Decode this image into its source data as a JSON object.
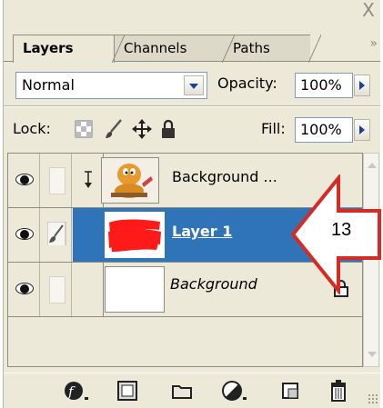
{
  "titlebar": {
    "close_glyph": "X"
  },
  "tabs": [
    {
      "label": "Layers",
      "active": true
    },
    {
      "label": "Channels",
      "active": false
    },
    {
      "label": "Paths",
      "active": false
    }
  ],
  "panel_menu_glyph": "»",
  "blend": {
    "mode": "Normal",
    "opacity_label": "Opacity:",
    "opacity_value": "100%"
  },
  "lock": {
    "label": "Lock:",
    "fill_label": "Fill:",
    "fill_value": "100%"
  },
  "layers": [
    {
      "name": "Background ...",
      "visible": true,
      "clipped": true,
      "selected": false
    },
    {
      "name": "Layer 1",
      "visible": true,
      "clipped": false,
      "selected": true
    },
    {
      "name": "Background",
      "visible": true,
      "clipped": false,
      "selected": false,
      "locked": true
    }
  ],
  "callout": {
    "number": "13",
    "color": "#d62b25"
  },
  "colors": {
    "panel": "#ece9d8",
    "selection": "#2f74b8",
    "layer_paint": "#ff1a1a"
  },
  "bottom_icons": [
    "layer-style-icon",
    "layer-mask-icon",
    "new-group-icon",
    "adjustment-layer-icon",
    "new-layer-icon",
    "trash-icon"
  ]
}
